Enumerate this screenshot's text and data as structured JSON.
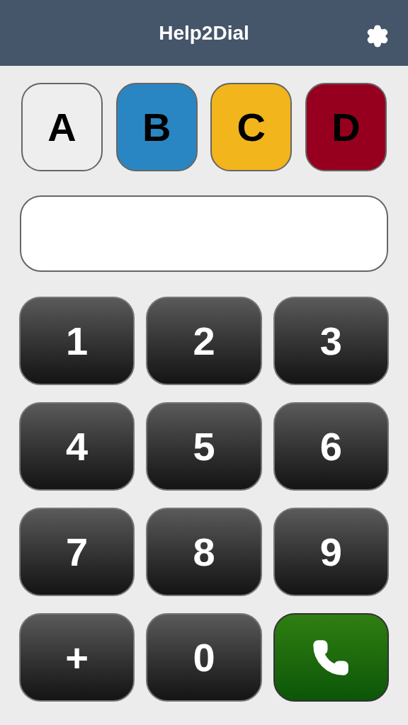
{
  "header": {
    "title": "Help2Dial"
  },
  "contacts": [
    {
      "label": "A",
      "color": "#eeeeee"
    },
    {
      "label": "B",
      "color": "#2a86c2"
    },
    {
      "label": "C",
      "color": "#f2b51c"
    },
    {
      "label": "D",
      "color": "#96001e"
    }
  ],
  "keypad": [
    {
      "kind": "digit",
      "label": "1"
    },
    {
      "kind": "digit",
      "label": "2"
    },
    {
      "kind": "digit",
      "label": "3"
    },
    {
      "kind": "digit",
      "label": "4"
    },
    {
      "kind": "digit",
      "label": "5"
    },
    {
      "kind": "digit",
      "label": "6"
    },
    {
      "kind": "digit",
      "label": "7"
    },
    {
      "kind": "digit",
      "label": "8"
    },
    {
      "kind": "digit",
      "label": "9"
    },
    {
      "kind": "digit",
      "label": "+"
    },
    {
      "kind": "digit",
      "label": "0"
    },
    {
      "kind": "call"
    }
  ]
}
